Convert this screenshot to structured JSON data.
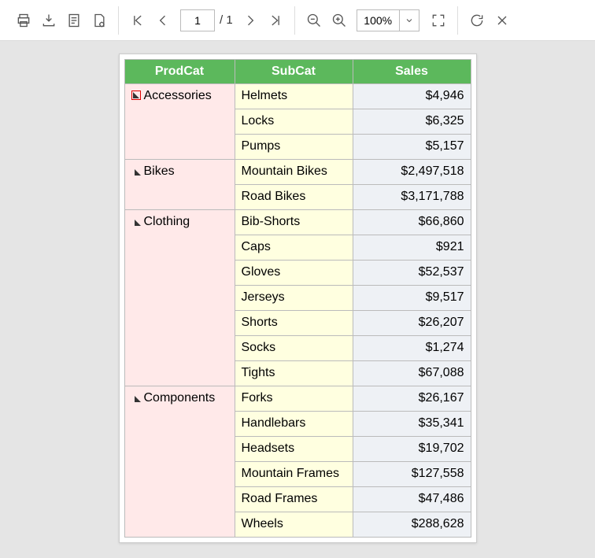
{
  "toolbar": {
    "page_current": "1",
    "page_total": "/ 1",
    "zoom_value": "100%"
  },
  "headers": {
    "prodcat": "ProdCat",
    "subcat": "SubCat",
    "sales": "Sales"
  },
  "categories": [
    {
      "name": "Accessories",
      "highlighted": true,
      "rows": [
        {
          "sub": "Helmets",
          "sales": "$4,946"
        },
        {
          "sub": "Locks",
          "sales": "$6,325"
        },
        {
          "sub": "Pumps",
          "sales": "$5,157"
        }
      ]
    },
    {
      "name": "Bikes",
      "highlighted": false,
      "rows": [
        {
          "sub": "Mountain Bikes",
          "sales": "$2,497,518"
        },
        {
          "sub": "Road Bikes",
          "sales": "$3,171,788"
        }
      ]
    },
    {
      "name": "Clothing",
      "highlighted": false,
      "rows": [
        {
          "sub": "Bib-Shorts",
          "sales": "$66,860"
        },
        {
          "sub": "Caps",
          "sales": "$921"
        },
        {
          "sub": "Gloves",
          "sales": "$52,537"
        },
        {
          "sub": "Jerseys",
          "sales": "$9,517"
        },
        {
          "sub": "Shorts",
          "sales": "$26,207"
        },
        {
          "sub": "Socks",
          "sales": "$1,274"
        },
        {
          "sub": "Tights",
          "sales": "$67,088"
        }
      ]
    },
    {
      "name": "Components",
      "highlighted": false,
      "rows": [
        {
          "sub": "Forks",
          "sales": "$26,167"
        },
        {
          "sub": "Handlebars",
          "sales": "$35,341"
        },
        {
          "sub": "Headsets",
          "sales": "$19,702"
        },
        {
          "sub": "Mountain Frames",
          "sales": "$127,558"
        },
        {
          "sub": "Road Frames",
          "sales": "$47,486"
        },
        {
          "sub": "Wheels",
          "sales": "$288,628"
        }
      ]
    }
  ]
}
